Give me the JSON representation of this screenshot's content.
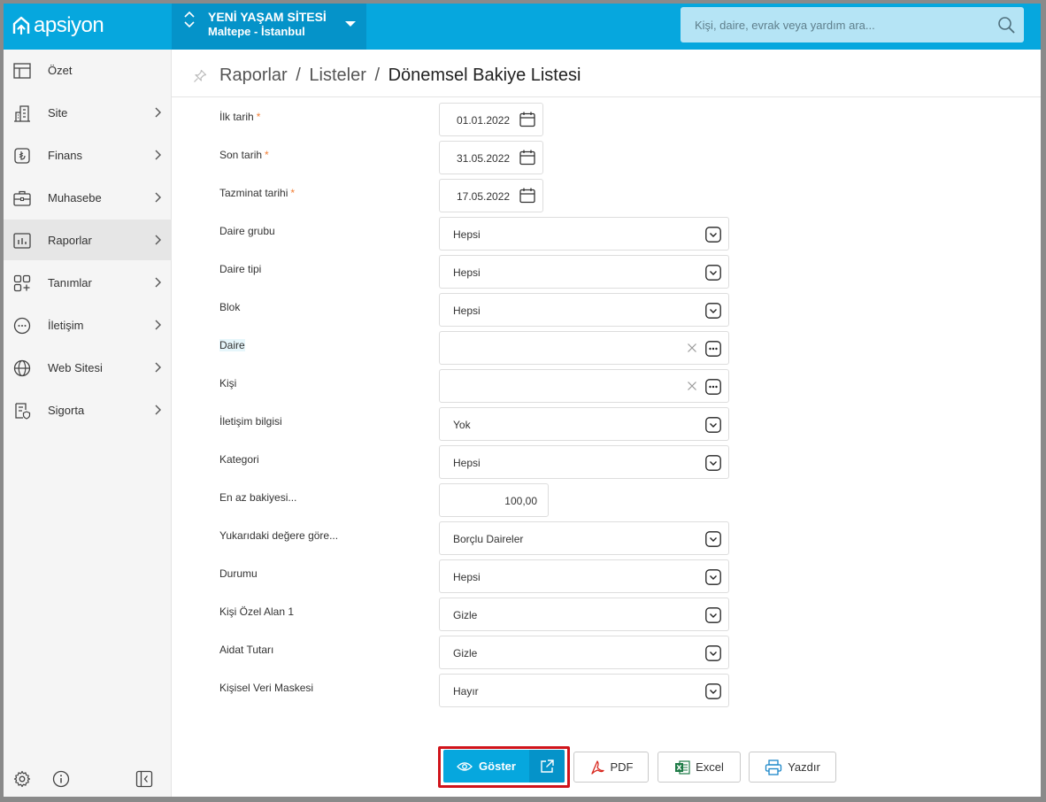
{
  "app": {
    "logo_text": "apsiyon"
  },
  "site": {
    "name": "YENİ YAŞAM SİTESİ",
    "location": "Maltepe - İstanbul"
  },
  "search": {
    "placeholder": "Kişi, daire, evrak veya yardım ara..."
  },
  "sidebar": {
    "items": [
      {
        "label": "Özet",
        "icon": "summary-icon"
      },
      {
        "label": "Site",
        "icon": "building-icon"
      },
      {
        "label": "Finans",
        "icon": "lira-icon"
      },
      {
        "label": "Muhasebe",
        "icon": "briefcase-icon"
      },
      {
        "label": "Raporlar",
        "icon": "chart-icon",
        "active": true
      },
      {
        "label": "Tanımlar",
        "icon": "grid-plus-icon"
      },
      {
        "label": "İletişim",
        "icon": "chat-icon"
      },
      {
        "label": "Web Sitesi",
        "icon": "globe-icon"
      },
      {
        "label": "Sigorta",
        "icon": "insurance-icon"
      }
    ]
  },
  "breadcrumb": {
    "part1": "Raporlar",
    "part2": "Listeler",
    "current": "Dönemsel Bakiye Listesi",
    "separator": "/"
  },
  "form": {
    "fields": [
      {
        "label": "İlk tarih",
        "required": true,
        "type": "date",
        "value": "01.01.2022"
      },
      {
        "label": "Son tarih",
        "required": true,
        "type": "date",
        "value": "31.05.2022"
      },
      {
        "label": "Tazminat tarihi",
        "required": true,
        "type": "date",
        "value": "17.05.2022"
      },
      {
        "label": "Daire grubu",
        "type": "select",
        "value": "Hepsi"
      },
      {
        "label": "Daire tipi",
        "type": "select",
        "value": "Hepsi"
      },
      {
        "label": "Blok",
        "type": "select",
        "value": "Hepsi"
      },
      {
        "label": "Daire",
        "type": "lookup",
        "value": ""
      },
      {
        "label": "Kişi",
        "type": "lookup",
        "value": ""
      },
      {
        "label": "İletişim bilgisi",
        "type": "select",
        "value": "Yok"
      },
      {
        "label": "Kategori",
        "type": "select",
        "value": "Hepsi"
      },
      {
        "label": "En az bakiyesi...",
        "type": "number",
        "value": "100,00"
      },
      {
        "label": "Yukarıdaki değere göre...",
        "type": "select",
        "value": "Borçlu Daireler"
      },
      {
        "label": "Durumu",
        "type": "select",
        "value": "Hepsi"
      },
      {
        "label": "Kişi Özel Alan 1",
        "type": "select",
        "value": "Gizle"
      },
      {
        "label": "Aidat Tutarı",
        "type": "select",
        "value": "Gizle"
      },
      {
        "label": "Kişisel Veri Maskesi",
        "type": "select",
        "value": "Hayır"
      }
    ],
    "required_mark": "*"
  },
  "actions": {
    "show": "Göster",
    "pdf": "PDF",
    "excel": "Excel",
    "print": "Yazdır"
  },
  "colors": {
    "brand": "#06a7de",
    "brand_dark": "#0593c9",
    "required": "#f27e35",
    "highlight": "#d0141b"
  }
}
